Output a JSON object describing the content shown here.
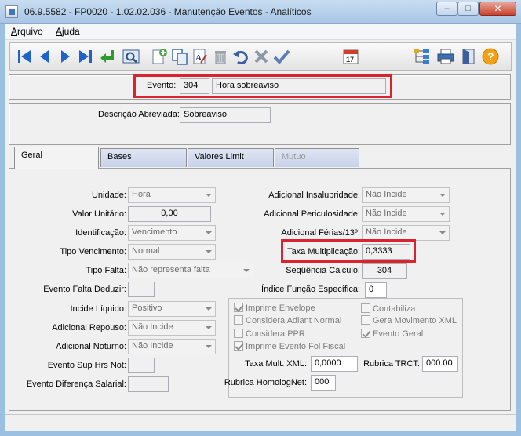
{
  "window": {
    "title": "06.9.5582 - FP0020 - 1.02.02.036 - Manutenção Eventos - Analíticos",
    "min_glyph": "–",
    "max_glyph": "□",
    "close_glyph": "✕"
  },
  "menu": {
    "arquivo_first": "A",
    "arquivo_rest": "rquivo",
    "ajuda_first": "A",
    "ajuda_rest": "juda"
  },
  "toolbar_icons": [
    "first-record-icon",
    "previous-record-icon",
    "next-record-icon",
    "last-record-icon",
    "return-icon",
    "search-icon",
    "new-record-icon",
    "copy-icon",
    "edit-icon",
    "delete-icon",
    "undo-icon",
    "cancel-icon",
    "confirm-icon",
    "calendar-icon",
    "tree-icon",
    "print-icon",
    "exit-icon",
    "help-icon"
  ],
  "calendar_day": "17",
  "help_glyph": "?",
  "accent_colors": {
    "highlight": "#d9232e",
    "nav_blue": "#1f63c9",
    "tab_blue": "#c8d2ea"
  },
  "evento": {
    "label": "Evento:",
    "code": "304",
    "name": "Hora sobreaviso"
  },
  "descricao": {
    "label": "Descrição Abreviada:",
    "value": "Sobreaviso"
  },
  "tabs": [
    {
      "label": "Geral"
    },
    {
      "label": "Bases"
    },
    {
      "label": "Valores Limit"
    },
    {
      "label": "Mutuo"
    }
  ],
  "left": {
    "unidade": {
      "label": "Unidade:",
      "value": "Hora"
    },
    "valor_unitario": {
      "label": "Valor Unitário:",
      "value": "0,00"
    },
    "identificacao": {
      "label": "Identificação:",
      "value": "Vencimento"
    },
    "tipo_vencimento": {
      "label": "Tipo Vencimento:",
      "value": "Normal"
    },
    "tipo_falta": {
      "label": "Tipo Falta:",
      "value": "Não representa falta"
    },
    "evento_falta_deduzir": {
      "label": "Evento Falta Deduzir:",
      "value": ""
    },
    "incide_liquido": {
      "label": "Incide Líquido:",
      "value": "Positivo"
    },
    "adicional_repouso": {
      "label": "Adicional Repouso:",
      "value": "Não Incide"
    },
    "adicional_noturno": {
      "label": "Adicional Noturno:",
      "value": "Não Incide"
    },
    "evento_sup_hrs": {
      "label": "Evento Sup Hrs Not:",
      "value": ""
    },
    "evento_dif_salarial": {
      "label": "Evento Diferença Salarial:",
      "value": ""
    }
  },
  "right": {
    "adicional_insalubridade": {
      "label": "Adicional Insalubridade:",
      "value": "Não Incide"
    },
    "adicional_periculosidade": {
      "label": "Adicional Periculosidade:",
      "value": "Não Incide"
    },
    "adicional_ferias": {
      "label": "Adicional Férias/13º:",
      "value": "Não Incide"
    },
    "taxa_multiplicacao": {
      "label": "Taxa Multiplicação:",
      "value": "0,3333"
    },
    "sequencia_calculo": {
      "label": "Seqüência Cálculo:",
      "value": "304"
    },
    "indice_funcao": {
      "label": "Índice Função Específica:",
      "value": "0"
    }
  },
  "checks": {
    "imprime_envelope": {
      "label": "Imprime Envelope",
      "checked": true
    },
    "considera_adiant": {
      "label": "Considera Adiant Normal",
      "checked": false
    },
    "considera_ppr": {
      "label": "Considera PPR",
      "checked": false
    },
    "imprime_evento_fol": {
      "label": "Imprime Evento Fol Fiscal",
      "checked": true
    },
    "contabiliza": {
      "label": "Contabiliza",
      "checked": false
    },
    "gera_movimento_xml": {
      "label": "Gera Movimento XML",
      "checked": false
    },
    "evento_geral": {
      "label": "Evento Geral",
      "checked": true
    }
  },
  "xml": {
    "taxa_mult_xml": {
      "label": "Taxa Mult. XML:",
      "value": "0,0000"
    },
    "rubrica_trct": {
      "label": "Rubrica TRCT:",
      "value": "000.00"
    },
    "rubrica_homolognet": {
      "label": "Rubrica HomologNet:",
      "value": "000"
    }
  }
}
